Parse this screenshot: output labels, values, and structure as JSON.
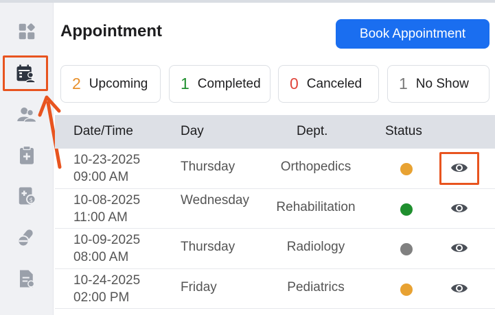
{
  "header": {
    "title": "Appointment",
    "book_button": "Book Appointment"
  },
  "sidebar": {
    "items": [
      {
        "name": "dashboard",
        "icon": "dashboard-icon",
        "active": false
      },
      {
        "name": "appointments",
        "icon": "calendar-user-icon",
        "active": true
      },
      {
        "name": "patients",
        "icon": "users-icon",
        "active": false
      },
      {
        "name": "clipboard",
        "icon": "clipboard-plus-icon",
        "active": false
      },
      {
        "name": "billing",
        "icon": "billing-icon",
        "active": false
      },
      {
        "name": "pharmacy",
        "icon": "pills-icon",
        "active": false
      },
      {
        "name": "reports",
        "icon": "document-icon",
        "active": false
      }
    ]
  },
  "stats": [
    {
      "count": "2",
      "label": "Upcoming",
      "color": "#e8912c"
    },
    {
      "count": "1",
      "label": "Completed",
      "color": "#1f8f2e"
    },
    {
      "count": "0",
      "label": "Canceled",
      "color": "#e0463c"
    },
    {
      "count": "1",
      "label": "No Show",
      "color": "#7a7a7a"
    }
  ],
  "table": {
    "headers": {
      "datetime": "Date/Time",
      "day": "Day",
      "dept": "Dept.",
      "status": "Status"
    },
    "rows": [
      {
        "date": "10-23-2025",
        "time": "09:00 AM",
        "day": "Thursday",
        "dept": "Orthopedics",
        "status_color": "#e8a232"
      },
      {
        "date": "10-08-2025",
        "time": "11:00 AM",
        "day": "Wednesday",
        "dept": "Rehabilitation",
        "status_color": "#1f8f2e"
      },
      {
        "date": "10-09-2025",
        "time": "08:00 AM",
        "day": "Thursday",
        "dept": "Radiology",
        "status_color": "#808080"
      },
      {
        "date": "10-24-2025",
        "time": "02:00 PM",
        "day": "Friday",
        "dept": "Pediatrics",
        "status_color": "#e8a232"
      }
    ]
  },
  "colors": {
    "accent": "#1a6ef0",
    "highlight": "#e8541f"
  }
}
